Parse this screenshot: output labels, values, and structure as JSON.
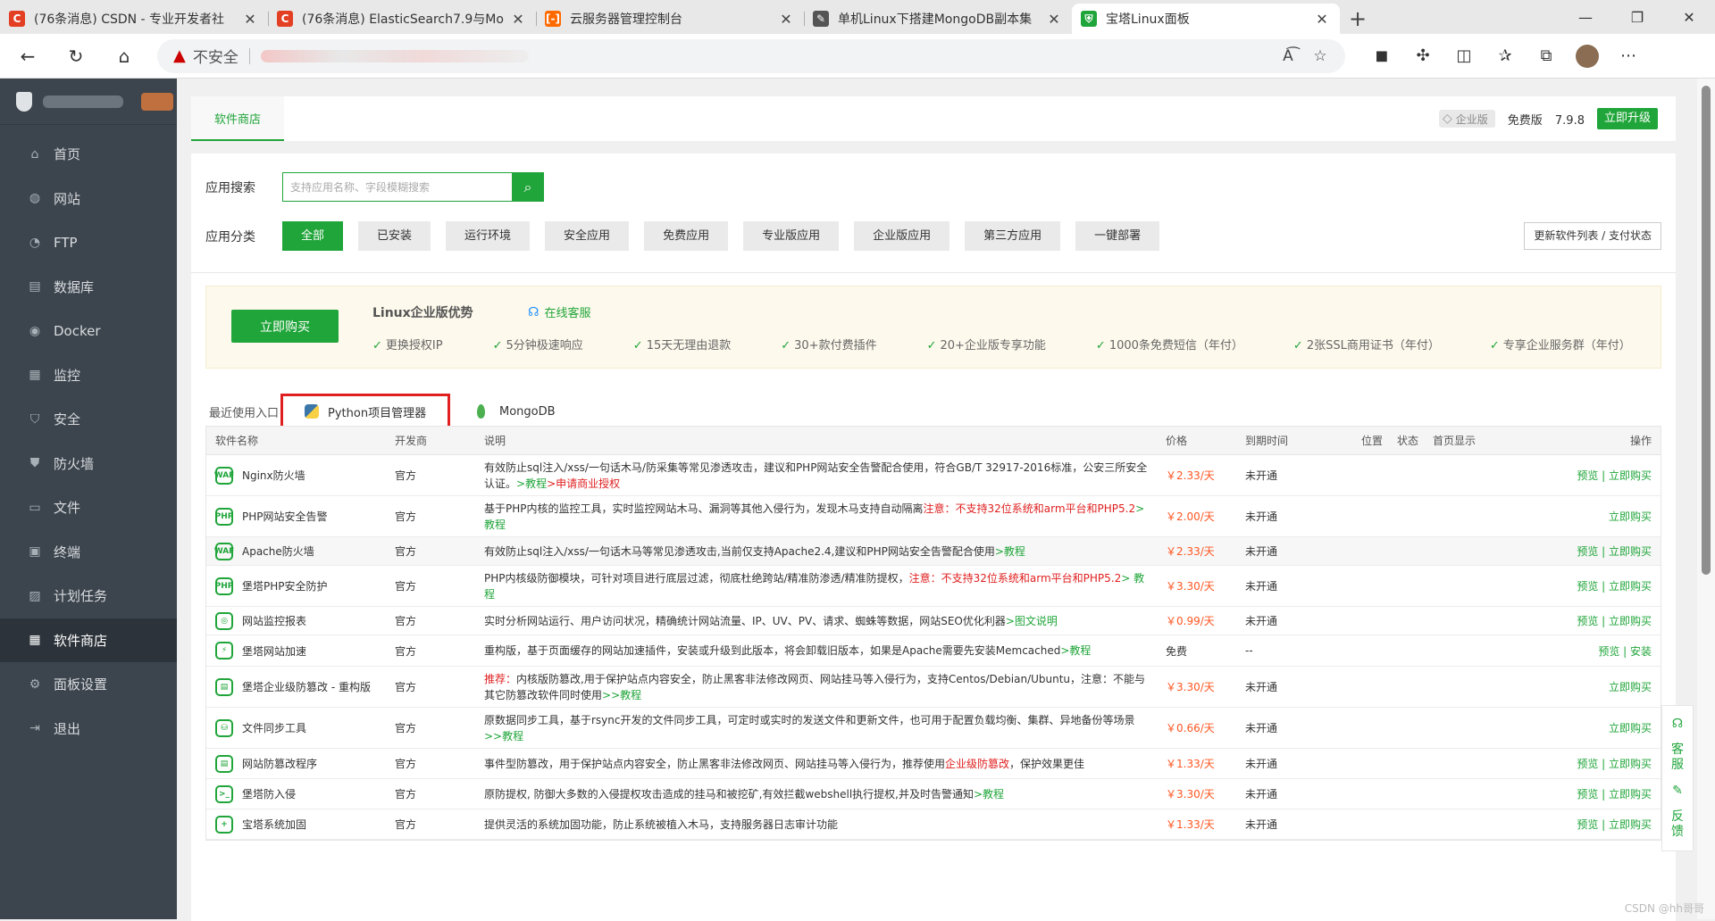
{
  "browser": {
    "tabs": [
      {
        "title": "(76条消息) CSDN - 专业开发者社",
        "fav": "C",
        "color": "#e33f22"
      },
      {
        "title": "(76条消息) ElasticSearch7.9与Mo",
        "fav": "C",
        "color": "#e33f22"
      },
      {
        "title": "云服务器管理控制台",
        "fav": "[-]",
        "color": "#ff6a00"
      },
      {
        "title": "单机Linux下搭建MongoDB副本集",
        "fav": "✎",
        "color": "#555555"
      },
      {
        "title": "宝塔Linux面板",
        "fav": "⛨",
        "color": "#20a53a"
      }
    ],
    "address": {
      "warn_text": "不安全"
    }
  },
  "sidebar": {
    "menu": [
      {
        "label": "首页",
        "icon": "⌂"
      },
      {
        "label": "网站",
        "icon": "◍"
      },
      {
        "label": "FTP",
        "icon": "◔"
      },
      {
        "label": "数据库",
        "icon": "▤"
      },
      {
        "label": "Docker",
        "icon": "◉"
      },
      {
        "label": "监控",
        "icon": "▦"
      },
      {
        "label": "安全",
        "icon": "⛉"
      },
      {
        "label": "防火墙",
        "icon": "⛊"
      },
      {
        "label": "文件",
        "icon": "▭"
      },
      {
        "label": "终端",
        "icon": "▣"
      },
      {
        "label": "计划任务",
        "icon": "▨"
      },
      {
        "label": "软件商店",
        "icon": "▦"
      },
      {
        "label": "面板设置",
        "icon": "⚙"
      },
      {
        "label": "退出",
        "icon": "⇥"
      }
    ],
    "active_index": 11
  },
  "topnav": {
    "tab": "软件商店",
    "enterprise": "企业版",
    "edition": "免费版",
    "version": "7.9.8",
    "upgrade": "立即升级"
  },
  "search": {
    "label": "应用搜索",
    "placeholder": "支持应用名称、字段模糊搜索"
  },
  "categories": {
    "label": "应用分类",
    "items": [
      "全部",
      "已安装",
      "运行环境",
      "安全应用",
      "免费应用",
      "专业版应用",
      "企业版应用",
      "第三方应用",
      "一键部署"
    ],
    "active": 0,
    "refresh": "更新软件列表 / 支付状态"
  },
  "promo": {
    "buy": "立即购买",
    "title": "Linux企业版优势",
    "service": "在线客服",
    "features": [
      "更换授权IP",
      "5分钟极速响应",
      "15天无理由退款",
      "30+款付费插件",
      "20+企业版专享功能",
      "1000条免费短信（年付）",
      "2张SSL商用证书（年付）",
      "专享企业服务群（年付）"
    ]
  },
  "recent": {
    "label": "最近使用入口",
    "items": [
      "Python项目管理器",
      "MongoDB"
    ]
  },
  "table": {
    "headers": {
      "name": "软件名称",
      "dev": "开发商",
      "desc": "说明",
      "price": "价格",
      "expire": "到期时间",
      "pos": "位置",
      "status": "状态",
      "home": "首页显示",
      "op": "操作"
    },
    "rows": [
      {
        "name": "Nginx防火墙",
        "icon": "WAF",
        "dev": "官方",
        "desc": "有效防止sql注入/xss/一句话木马/防采集等常见渗透攻击，建议和PHP网站安全告警配合使用，符合GB/T 32917-2016标准，公安三所安全认证。",
        "desc_green": ">教程",
        "desc_red": ">申请商业授权",
        "price": "￥2.33/天",
        "expire": "未开通",
        "op": "预览 | 立即购买",
        "h": 46
      },
      {
        "name": "PHP网站安全告警",
        "icon": "PHP",
        "dev": "官方",
        "desc": "基于PHP内核的监控工具，实时监控网站木马、漏洞等其他入侵行为，发现木马支持自动隔离",
        "desc_red": "注意：不支持32位系统和arm平台和PHP5.2",
        "desc_green": "> 教程",
        "price": "￥2.00/天",
        "expire": "未开通",
        "op": "立即购买",
        "h": 46
      },
      {
        "name": "Apache防火墙",
        "icon": "WAF",
        "dev": "官方",
        "desc": "有效防止sql注入/xss/一句话木马等常见渗透攻击,当前仅支持Apache2.4,建议和PHP网站安全告警配合使用",
        "desc_green": ">教程",
        "price": "￥2.33/天",
        "expire": "未开通",
        "op": "预览 | 立即购买",
        "h": 32,
        "alt": true
      },
      {
        "name": "堡塔PHP安全防护",
        "icon": "PHP",
        "dev": "官方",
        "desc": "PHP内核级防御模块，可针对项目进行底层过滤，彻底杜绝跨站/精准防渗透/精准防提权，",
        "desc_red": "注意：不支持32位系统和arm平台和PHP5.2",
        "desc_green": "> 教程",
        "price": "￥3.30/天",
        "expire": "未开通",
        "op": "预览 | 立即购买",
        "h": 46
      },
      {
        "name": "网站监控报表",
        "icon": "◎",
        "dev": "官方",
        "desc": "实时分析网站运行、用户访问状况，精确统计网站流量、IP、UV、PV、请求、蜘蛛等数据，网站SEO优化利器",
        "desc_green": ">图文说明",
        "price": "￥0.99/天",
        "expire": "未开通",
        "op": "预览 | 立即购买",
        "h": 32
      },
      {
        "name": "堡塔网站加速",
        "icon": "⚡",
        "dev": "官方",
        "desc": "重构版，基于页面缓存的网站加速插件，安装或升级到此版本，将会卸载旧版本，如果是Apache需要先安装Memcached",
        "desc_green": ">教程",
        "price": "免费",
        "expire": "--",
        "op": "预览 | 安装",
        "h": 35,
        "free": true
      },
      {
        "name": "堡塔企业级防篡改 - 重构版",
        "icon": "▤",
        "dev": "官方",
        "desc_red_prefix": "推荐：",
        "desc": "内核版防篡改,用于保护站点内容安全，防止黑客非法修改网页、网站挂马等入侵行为，支持Centos/Debian/Ubuntu，注意：不能与其它防篡改软件同时使用",
        "desc_green": ">>教程",
        "price": "￥3.30/天",
        "expire": "未开通",
        "op": "立即购买",
        "h": 46
      },
      {
        "name": "文件同步工具",
        "icon": "⛁",
        "dev": "官方",
        "desc": "原数据同步工具，基于rsync开发的文件同步工具，可定时或实时的发送文件和更新文件，也可用于配置负载均衡、集群、异地备份等场景",
        "desc_green": ">>教程",
        "price": "￥0.66/天",
        "expire": "未开通",
        "op": "立即购买",
        "h": 46
      },
      {
        "name": "网站防篡改程序",
        "icon": "▤",
        "dev": "官方",
        "desc": "事件型防篡改，用于保护站点内容安全，防止黑客非法修改网页、网站挂马等入侵行为，推荐使用",
        "desc_red": "企业级防篡改",
        "desc_tail": "，保护效果更佳",
        "price": "￥1.33/天",
        "expire": "未开通",
        "op": "预览 | 立即购买",
        "h": 34
      },
      {
        "name": "堡塔防入侵",
        "icon": ">_",
        "dev": "官方",
        "desc": "原防提权, 防御大多数的入侵提权攻击造成的挂马和被挖矿,有效拦截webshell执行提权,并及时告警通知",
        "desc_green": ">教程",
        "price": "￥3.30/天",
        "expire": "未开通",
        "op": "预览 | 立即购买",
        "h": 34
      },
      {
        "name": "宝塔系统加固",
        "icon": "+",
        "dev": "官方",
        "desc": "提供灵活的系统加固功能，防止系统被植入木马，支持服务器日志审计功能",
        "price": "￥1.33/天",
        "expire": "未开通",
        "op": "预览 | 立即购买",
        "h": 34
      }
    ]
  },
  "float": {
    "service": "客服",
    "feedback": "反馈"
  },
  "watermark": "CSDN @hh哥哥"
}
